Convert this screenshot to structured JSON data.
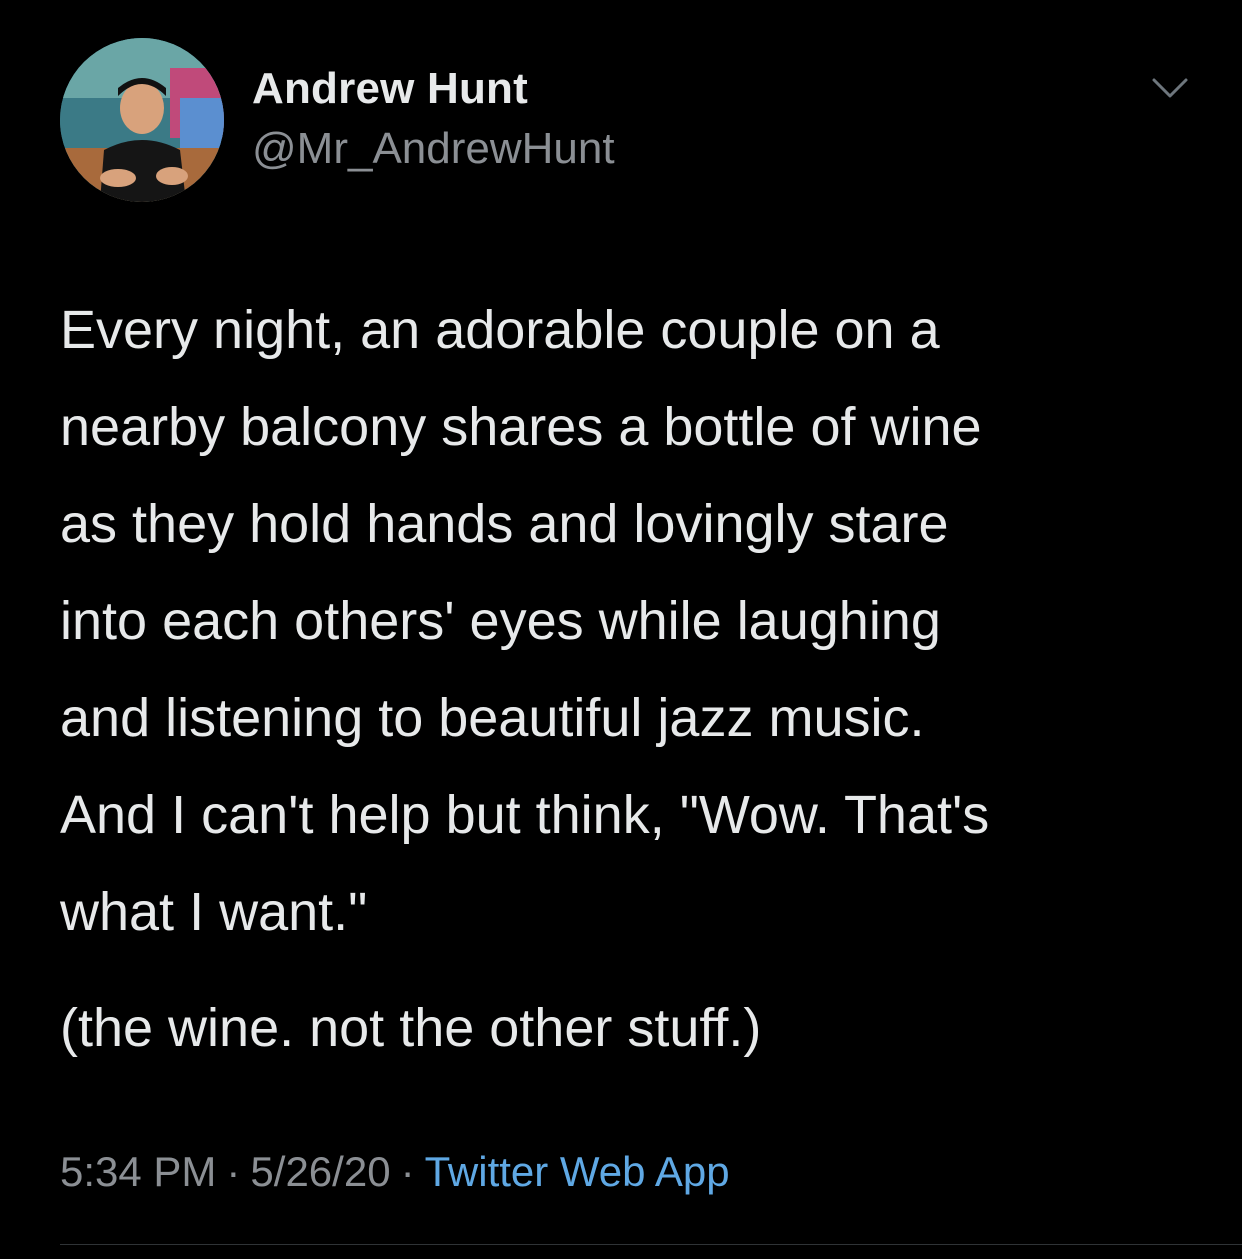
{
  "author": {
    "display_name": "Andrew Hunt",
    "handle": "@Mr_AndrewHunt",
    "avatar_icon": "profile-photo"
  },
  "tweet": {
    "lines": [
      "Every night, an adorable couple on a",
      "nearby balcony shares a bottle of wine",
      "as they hold hands and lovingly stare",
      "into each others' eyes while laughing",
      "and listening to beautiful jazz music.",
      "And I can't help but think, \"Wow. That's",
      "what I want.\""
    ],
    "second_paragraph": "(the wine. not the other stuff.)"
  },
  "meta": {
    "time": "5:34 PM",
    "separator": "·",
    "date": "5/26/20",
    "source": "Twitter Web App"
  },
  "colors": {
    "background": "#000000",
    "text_primary": "#e7e9ea",
    "text_secondary": "#8b8f94",
    "link": "#5fa8e4"
  }
}
